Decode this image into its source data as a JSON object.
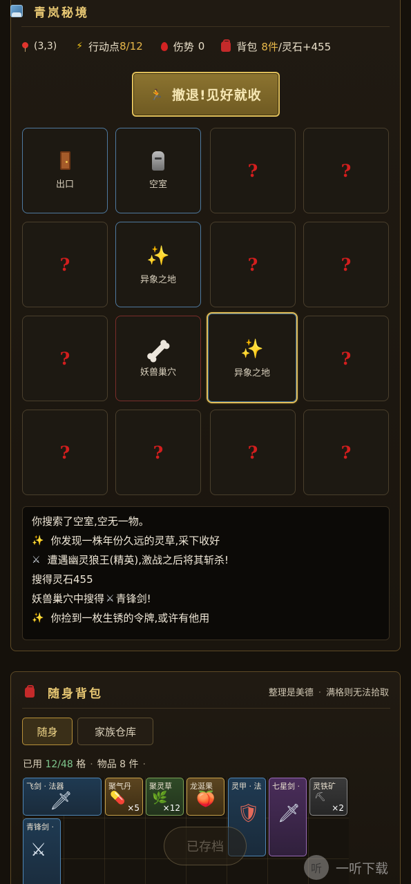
{
  "header": {
    "title": "青岚秘境",
    "icon": "map-scroll-icon"
  },
  "stats": {
    "position": "(3,3)",
    "action_label": "行动点",
    "action_value": "8/12",
    "injury_label": "伤势",
    "injury_value": "0",
    "bag_label": "背包",
    "bag_count": "8件",
    "spirit_stone": "/灵石+455"
  },
  "retreat_button": {
    "label": "撤退!见好就收",
    "icon": "running-person-icon"
  },
  "map": {
    "rows": [
      [
        {
          "type": "exit",
          "label": "出口"
        },
        {
          "type": "empty",
          "label": "空室"
        },
        {
          "type": "unknown",
          "label": "?"
        },
        {
          "type": "unknown",
          "label": "?"
        }
      ],
      [
        {
          "type": "unknown",
          "label": "?"
        },
        {
          "type": "anomaly",
          "label": "异象之地"
        },
        {
          "type": "unknown",
          "label": "?"
        },
        {
          "type": "unknown",
          "label": "?"
        }
      ],
      [
        {
          "type": "unknown",
          "label": "?"
        },
        {
          "type": "lair",
          "label": "妖兽巢穴"
        },
        {
          "type": "anomaly",
          "label": "异象之地",
          "current": true
        },
        {
          "type": "unknown",
          "label": "?"
        }
      ],
      [
        {
          "type": "unknown",
          "label": "?"
        },
        {
          "type": "unknown",
          "label": "?"
        },
        {
          "type": "unknown",
          "label": "?"
        },
        {
          "type": "unknown",
          "label": "?"
        }
      ]
    ]
  },
  "log": {
    "lines": [
      "你搜索了空室,空无一物。",
      "你发现一株年份久远的灵草,采下收好",
      "遭遇幽灵狼王(精英),激战之后将其斩杀!",
      "搜得灵石455",
      "妖兽巢穴中搜得",
      "青锋剑!",
      "你捡到一枚生锈的令牌,或许有他用"
    ]
  },
  "bag": {
    "title": "随身背包",
    "tip1": "整理是美德",
    "tip2": "满格则无法拾取",
    "tabs": [
      "随身",
      "家族仓库"
    ],
    "used_label": "已用",
    "used_value": "12/48",
    "used_unit": "格",
    "items_label": "物品",
    "items_value": "8",
    "items_unit": "件",
    "items": [
      {
        "name": "飞剑 · 法器",
        "qty": "",
        "color": "blue",
        "icon": "sword-icon"
      },
      {
        "name": "聚气丹",
        "qty": "×5",
        "color": "gold",
        "icon": "pill-icon"
      },
      {
        "name": "聚灵草",
        "qty": "×12",
        "color": "green",
        "icon": "herb-icon"
      },
      {
        "name": "龙涎果",
        "qty": "",
        "color": "gold",
        "icon": "peach-icon"
      },
      {
        "name": "灵甲 · 法",
        "qty": "",
        "color": "blue",
        "icon": "shield-icon"
      },
      {
        "name": "七星剑 ·",
        "qty": "",
        "color": "purple",
        "icon": "dagger-icon"
      },
      {
        "name": "灵铁矿",
        "qty": "×2",
        "color": "gray",
        "icon": "ore-icon"
      },
      {
        "name": "青锋剑 ·",
        "qty": "",
        "color": "blue",
        "icon": "crossed-swords-icon"
      }
    ]
  },
  "saved_label": "已存档",
  "watermark": {
    "logo": "听",
    "text": "一听下载"
  },
  "colors": {
    "accent": "#e8c873",
    "panel_border": "#5e4a26",
    "danger": "#d31e1e",
    "highlight": "#e2bd57"
  }
}
